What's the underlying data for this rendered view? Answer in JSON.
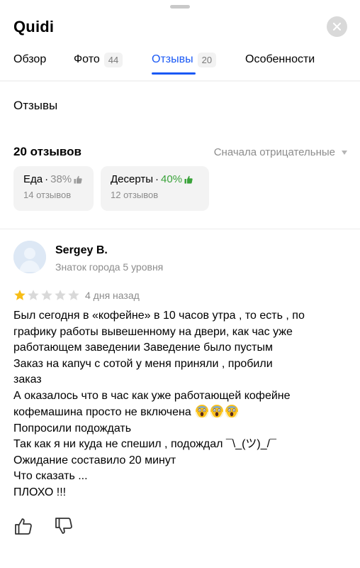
{
  "app": {
    "title": "Quidi"
  },
  "tabs": [
    {
      "label": "Обзор",
      "badge": ""
    },
    {
      "label": "Фото",
      "badge": "44"
    },
    {
      "label": "Отзывы",
      "badge": "20",
      "active": true
    },
    {
      "label": "Особенности",
      "badge": ""
    }
  ],
  "section": {
    "title": "Отзывы"
  },
  "reviews_header": {
    "count_label": "20 отзывов",
    "sort_value": "Сначала отрицательные"
  },
  "aspect_chips": [
    {
      "name": "Еда",
      "separator": "·",
      "percent": "38%",
      "sentiment": "negative",
      "reviews": "14 отзывов"
    },
    {
      "name": "Десерты",
      "separator": "·",
      "percent": "40%",
      "sentiment": "positive",
      "reviews": "12 отзывов"
    }
  ],
  "review": {
    "author": "Sergey B.",
    "author_level": "Знаток города 5 уровня",
    "rating": 1,
    "rating_max": 5,
    "date": "4 дня назад",
    "lines": [
      "Был сегодня в «кофейне» в 10 часов утра , то есть , по",
      "графику работы вывешенному на двери, как час уже",
      "работающем заведении Заведение было пустым",
      "Заказ на капуч с сотой у меня приняли , пробили",
      "заказ",
      "А оказалось что в час как уже работающей кофейне",
      "кофемашина просто не включена",
      "Попросили подождать",
      "Так как я ни куда не спешил , подождал ¯\\_(ツ)_/¯",
      "Ожидание составило 20 минут",
      "Что сказать ...",
      "ПЛОХО !!!"
    ],
    "emoji_name": "screaming-face-emoji",
    "emoji_count": 3
  },
  "colors": {
    "accent": "#1a59f5",
    "positive": "#3aa33a",
    "star_filled": "#f7bd16",
    "star_empty": "#d9d9d9",
    "muted_text": "#8c8c8c",
    "chip_bg": "#f3f3f3"
  },
  "icons": {
    "close": "close-icon",
    "sort_caret": "caret-down-icon",
    "like": "thumbs-up-icon",
    "dislike": "thumbs-down-icon",
    "avatar": "avatar-placeholder"
  }
}
